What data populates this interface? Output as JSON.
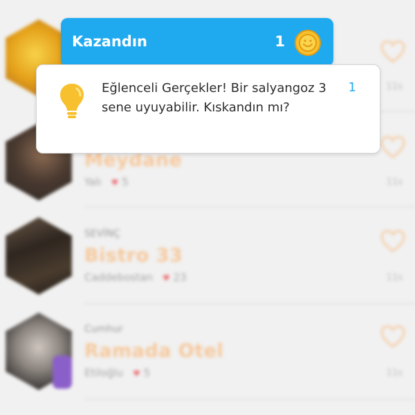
{
  "popup": {
    "earned_title": "Kazandın",
    "earned_count": "1",
    "coin_icon": "coin-icon",
    "fact_text": "Eğlenceli Gerçekler! Bir salyangoz 3 sene uyuyabilir. Kıskandın mı?",
    "fact_count": "1",
    "fact_icon": "lightbulb-icon"
  },
  "feed": {
    "items": [
      {
        "user": "",
        "venue": "",
        "location": "",
        "likes": "",
        "time": ""
      },
      {
        "user": "",
        "venue": "Meydane",
        "location": "Yalı",
        "likes": "5",
        "time": "11s"
      },
      {
        "user": "SEVİNÇ",
        "venue": "Bistro 33",
        "location": "Caddebostan",
        "likes": "23",
        "time": "11s"
      },
      {
        "user": "Cumhur",
        "venue": "Ramada Otel",
        "location": "Etiloğlu",
        "likes": "5",
        "time": "11s"
      }
    ]
  },
  "colors": {
    "accent_blue": "#1faaf0",
    "venue_orange": "#f6c89c",
    "heart_red": "#ec6e72",
    "coin_yellow": "#f7c02e"
  }
}
